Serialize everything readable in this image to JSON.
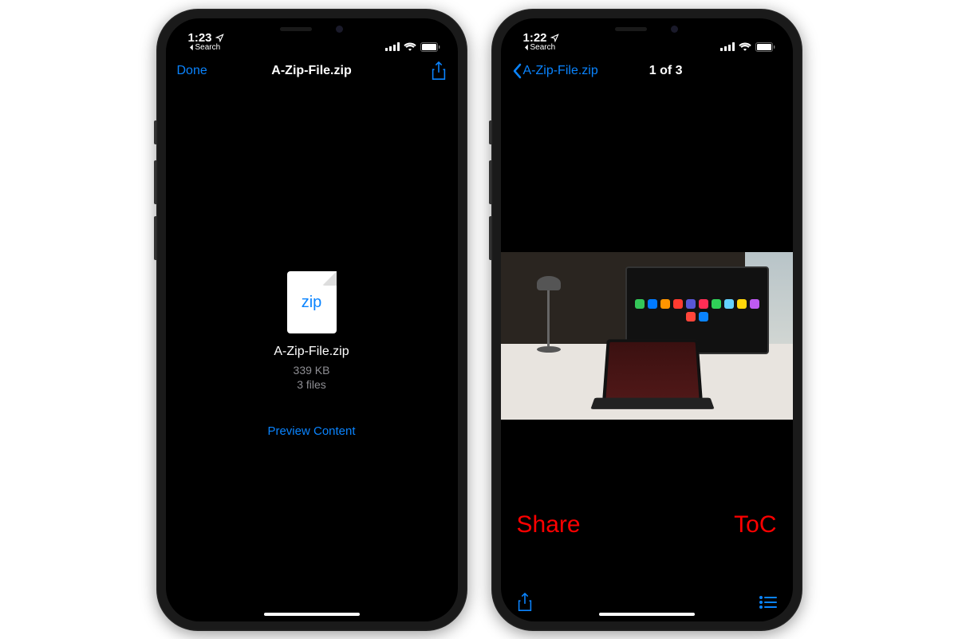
{
  "left": {
    "status": {
      "time": "1:23",
      "back_label": "Search"
    },
    "nav": {
      "left_label": "Done",
      "title": "A-Zip-File.zip"
    },
    "file": {
      "icon_text": "zip",
      "name": "A-Zip-File.zip",
      "size": "339 KB",
      "count": "3 files"
    },
    "preview_link": "Preview Content"
  },
  "right": {
    "status": {
      "time": "1:22",
      "back_label": "Search"
    },
    "nav": {
      "back_label": "A-Zip-File.zip",
      "title": "1 of 3"
    },
    "annotations": {
      "share": "Share",
      "toc": "ToC"
    }
  }
}
